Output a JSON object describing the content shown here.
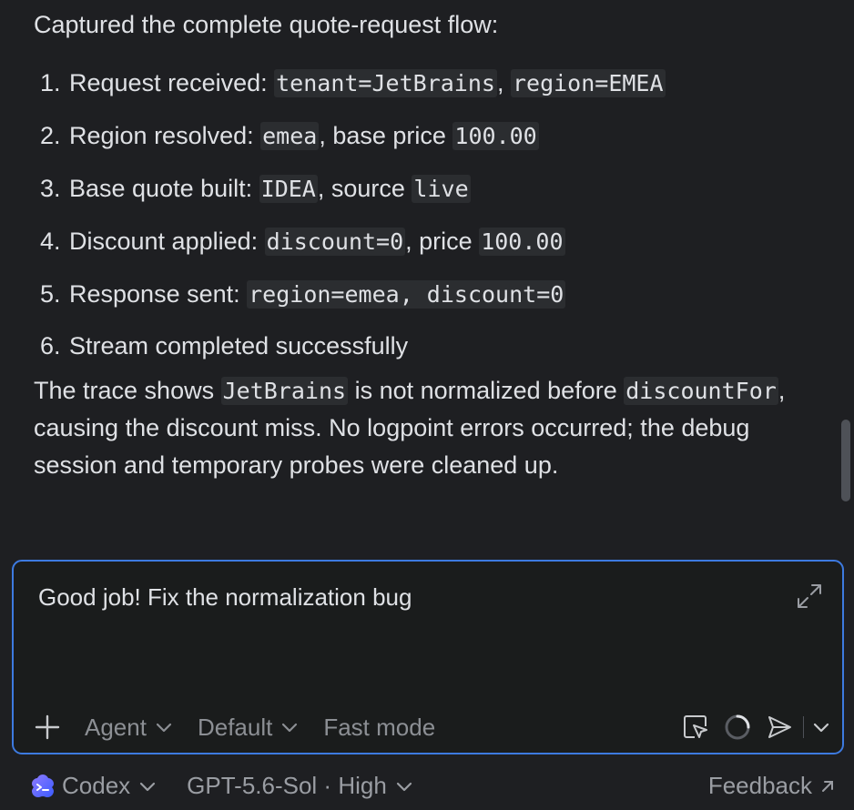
{
  "message": {
    "intro": "Captured the complete quote-request flow:",
    "steps": [
      {
        "num": "1.",
        "parts": [
          {
            "t": "Request received: "
          },
          {
            "c": "tenant=JetBrains"
          },
          {
            "t": ", "
          },
          {
            "c": "region=EMEA"
          }
        ]
      },
      {
        "num": "2.",
        "parts": [
          {
            "t": "Region resolved: "
          },
          {
            "c": "emea"
          },
          {
            "t": ", base price "
          },
          {
            "c": "100.00"
          }
        ]
      },
      {
        "num": "3.",
        "parts": [
          {
            "t": "Base quote built: "
          },
          {
            "c": "IDEA"
          },
          {
            "t": ", source "
          },
          {
            "c": "live"
          }
        ]
      },
      {
        "num": "4.",
        "parts": [
          {
            "t": "Discount applied: "
          },
          {
            "c": "discount=0"
          },
          {
            "t": ", price "
          },
          {
            "c": "100.00"
          }
        ]
      },
      {
        "num": "5.",
        "parts": [
          {
            "t": "Response sent: "
          },
          {
            "c": "region=emea, discount=0"
          }
        ]
      },
      {
        "num": "6.",
        "parts": [
          {
            "t": "Stream completed successfully"
          }
        ]
      }
    ],
    "summary_parts": [
      {
        "t": "The trace shows "
      },
      {
        "c": "JetBrains"
      },
      {
        "t": " is not normalized before "
      },
      {
        "c": "discountFor"
      },
      {
        "t": ", causing the discount miss. No logpoint errors occurred; the debug session and temporary probes were cleaned up."
      }
    ]
  },
  "composer": {
    "value": "Good job! Fix the normalization bug",
    "agent_label": "Agent",
    "mode_label": "Default",
    "fast_label": "Fast mode"
  },
  "footer": {
    "provider": "Codex",
    "model": "GPT-5.6-Sol · High",
    "feedback": "Feedback"
  },
  "colors": {
    "accent": "#3d7ae0",
    "background": "#1e1f22",
    "code_background": "#2b2d30"
  }
}
